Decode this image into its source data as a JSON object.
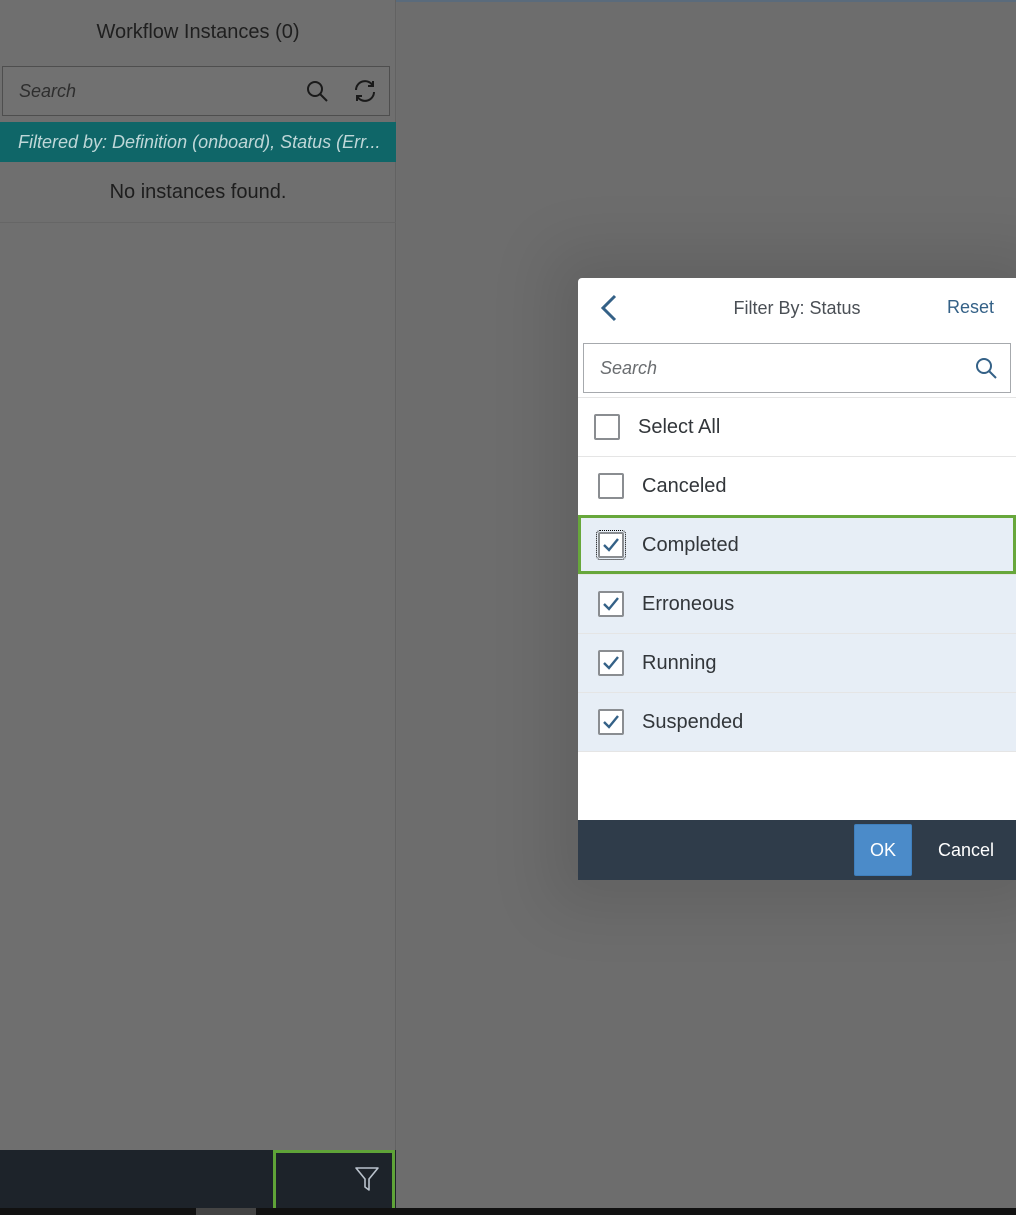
{
  "master": {
    "title": "Workflow Instances (0)",
    "search_placeholder": "Search",
    "filter_info": "Filtered by: Definition (onboard), Status (Err...",
    "no_data": "No instances found."
  },
  "dialog": {
    "title": "Filter By: Status",
    "reset_label": "Reset",
    "search_placeholder": "Search",
    "items": [
      {
        "label": "Select All",
        "checked": false
      },
      {
        "label": "Canceled",
        "checked": false
      },
      {
        "label": "Completed",
        "checked": true
      },
      {
        "label": "Erroneous",
        "checked": true
      },
      {
        "label": "Running",
        "checked": true
      },
      {
        "label": "Suspended",
        "checked": true
      }
    ],
    "ok_label": "OK",
    "cancel_label": "Cancel"
  },
  "colors": {
    "filter_bar": "#0f6668",
    "focus_outline": "#67a73b",
    "ok_button": "#4b8bc9",
    "dialog_footer": "#2f3c4a"
  },
  "icons": [
    "search-icon",
    "refresh-icon",
    "filter-icon",
    "back-arrow-icon",
    "checkmark-icon"
  ]
}
